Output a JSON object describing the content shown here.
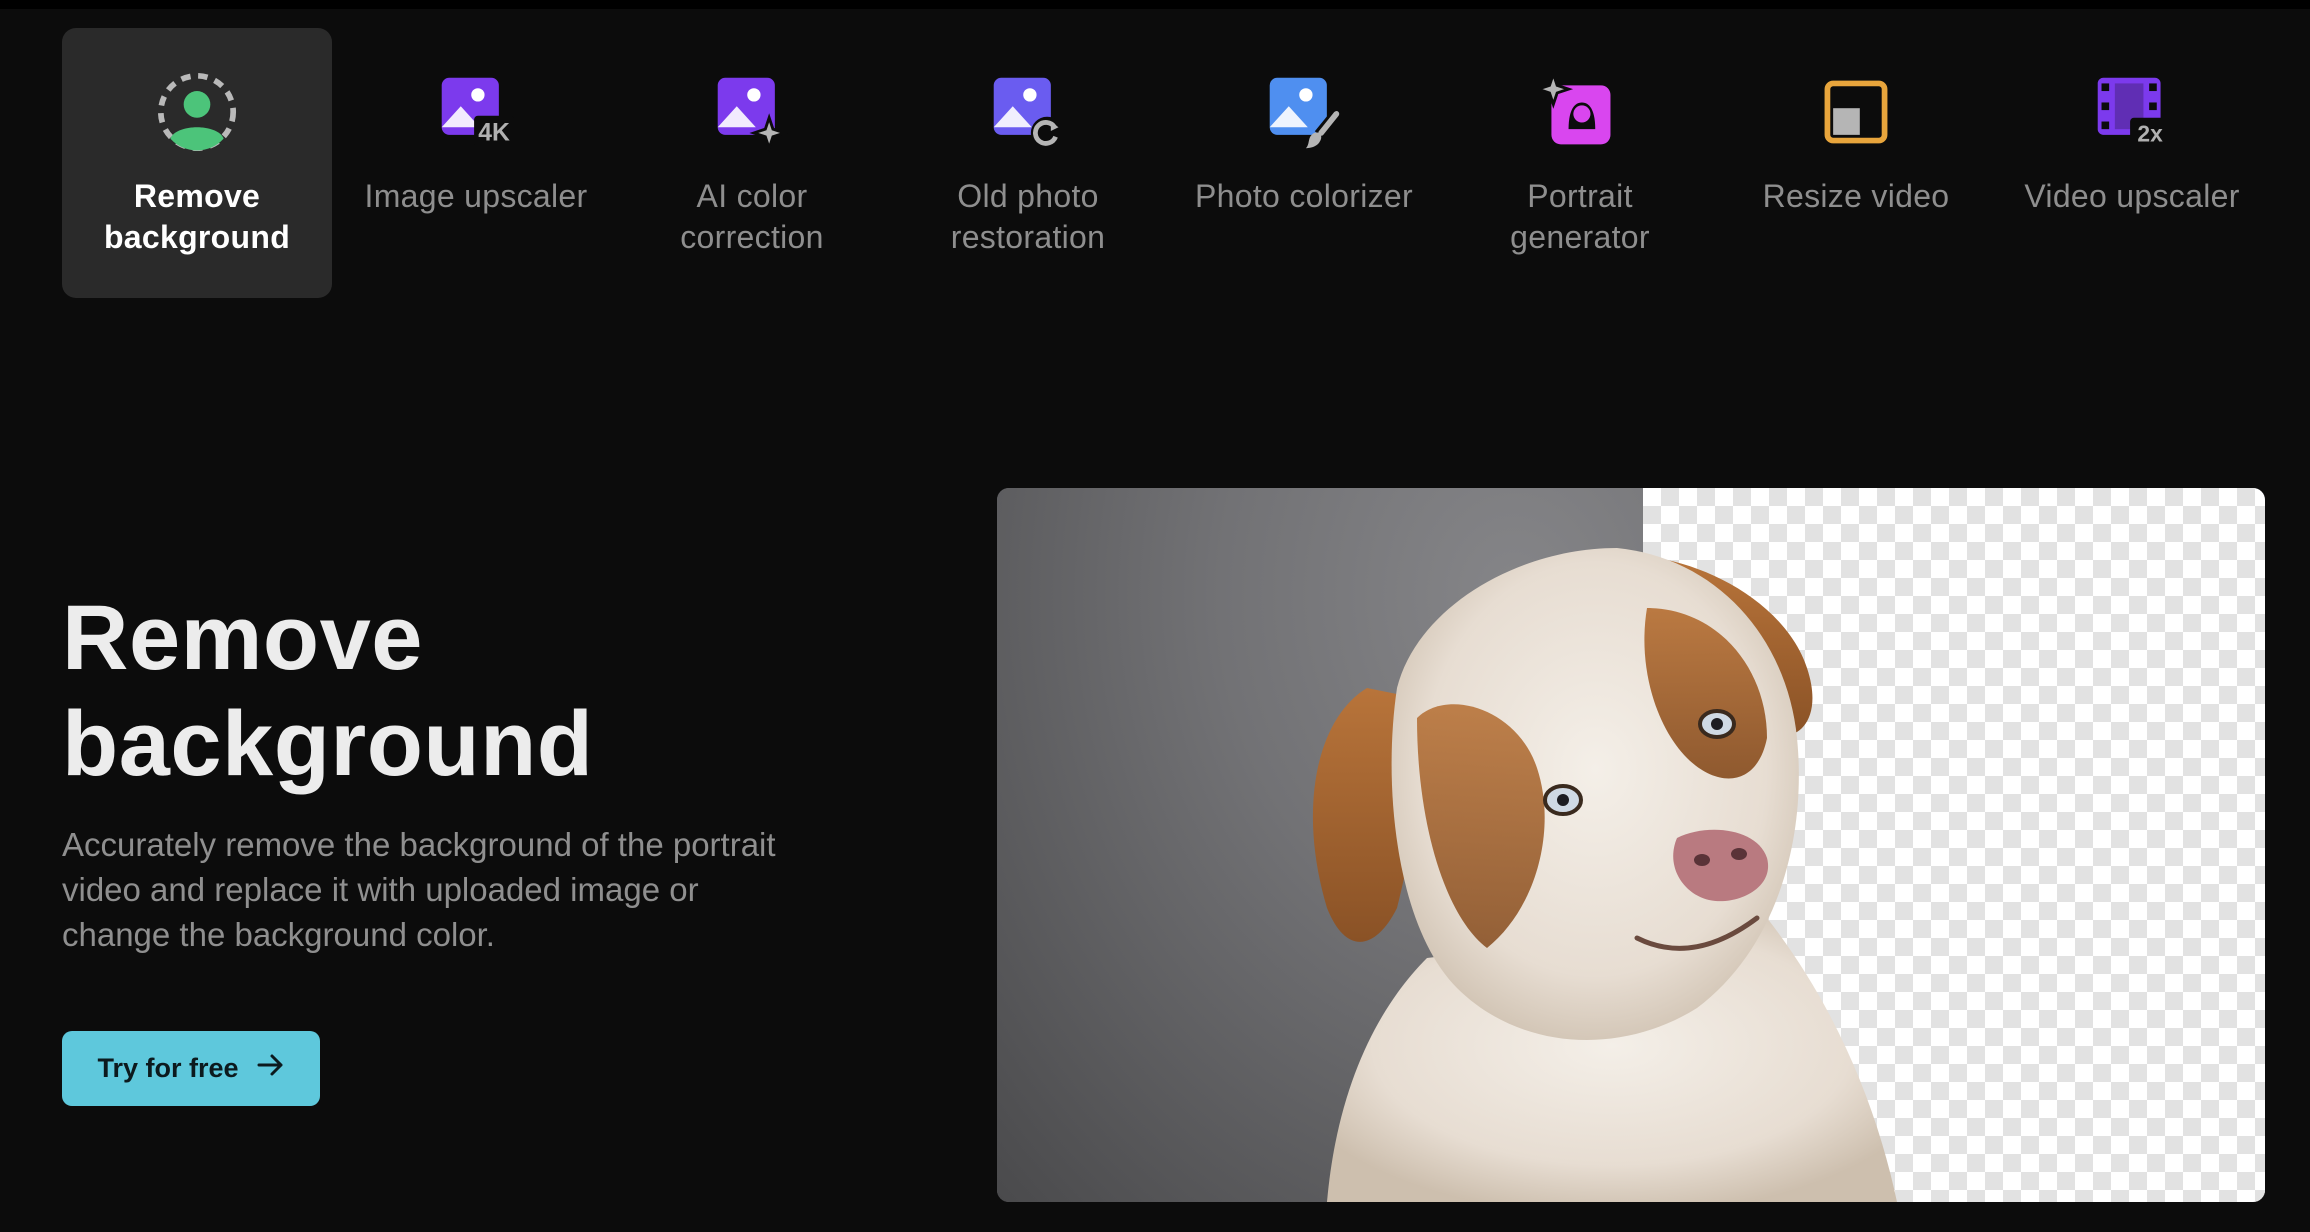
{
  "tool_tabs": [
    {
      "label": "Remove\nbackground",
      "icon": "remove-background-icon",
      "active": true
    },
    {
      "label": "Image upscaler",
      "icon": "image-upscaler-4k-icon",
      "active": false
    },
    {
      "label": "AI color\ncorrection",
      "icon": "ai-color-correction-icon",
      "active": false
    },
    {
      "label": "Old photo\nrestoration",
      "icon": "old-photo-restoration-icon",
      "active": false
    },
    {
      "label": "Photo colorizer",
      "icon": "photo-colorizer-icon",
      "active": false
    },
    {
      "label": "Portrait\ngenerator",
      "icon": "portrait-generator-icon",
      "active": false
    },
    {
      "label": "Resize video",
      "icon": "resize-video-icon",
      "active": false
    },
    {
      "label": "Video upscaler",
      "icon": "video-upscaler-2x-icon",
      "active": false
    }
  ],
  "hero": {
    "title": "Remove\nbackground",
    "description": "Accurately remove the background of the portrait video and replace it with uploaded image or change the background color.",
    "cta_label": "Try for free",
    "cta_icon": "arrow-right-icon"
  },
  "preview": {
    "subject": "dog-portrait",
    "left_background": "gray-studio",
    "right_background": "transparent-checkerboard"
  },
  "colors": {
    "page_background": "#0c0c0c",
    "active_tab_background": "#2a2a2a",
    "cta_background": "#5ec8dc",
    "purple_icon": "#7c3aed",
    "blue_icon": "#4f8ff0",
    "magenta_icon": "#d946ef",
    "orange_icon": "#e8a53c",
    "green_icon": "#4cc47a"
  }
}
